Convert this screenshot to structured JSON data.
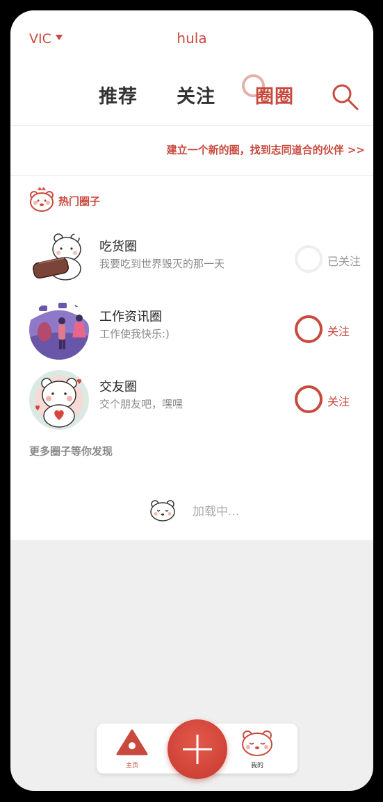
{
  "header": {
    "user": "VIC",
    "app_name": "hula"
  },
  "tabs": [
    {
      "label": "推荐",
      "active": false
    },
    {
      "label": "关注",
      "active": false
    },
    {
      "label": "圈圈",
      "active": true
    }
  ],
  "create_link": "建立一个新的圈，找到志同道合的伙伴 >>",
  "hot_section": {
    "title": "热门圈子",
    "circles": [
      {
        "name": "吃货圈",
        "desc": "我要吃到世界毁灭的那一天",
        "follow_label": "已关注",
        "followed": true
      },
      {
        "name": "工作资讯圈",
        "desc": "工作使我快乐:)",
        "follow_label": "关注",
        "followed": false
      },
      {
        "name": "交友圈",
        "desc": "交个朋友吧，嘿嘿",
        "follow_label": "关注",
        "followed": false
      }
    ]
  },
  "more_title": "更多圈子等你发现",
  "loading_text": "加载中...",
  "bottom_nav": {
    "home_label": "主页",
    "add_icon": "plus-icon",
    "mine_label": "我的"
  },
  "colors": {
    "accent": "#c84a3e",
    "background": "#efefef"
  }
}
